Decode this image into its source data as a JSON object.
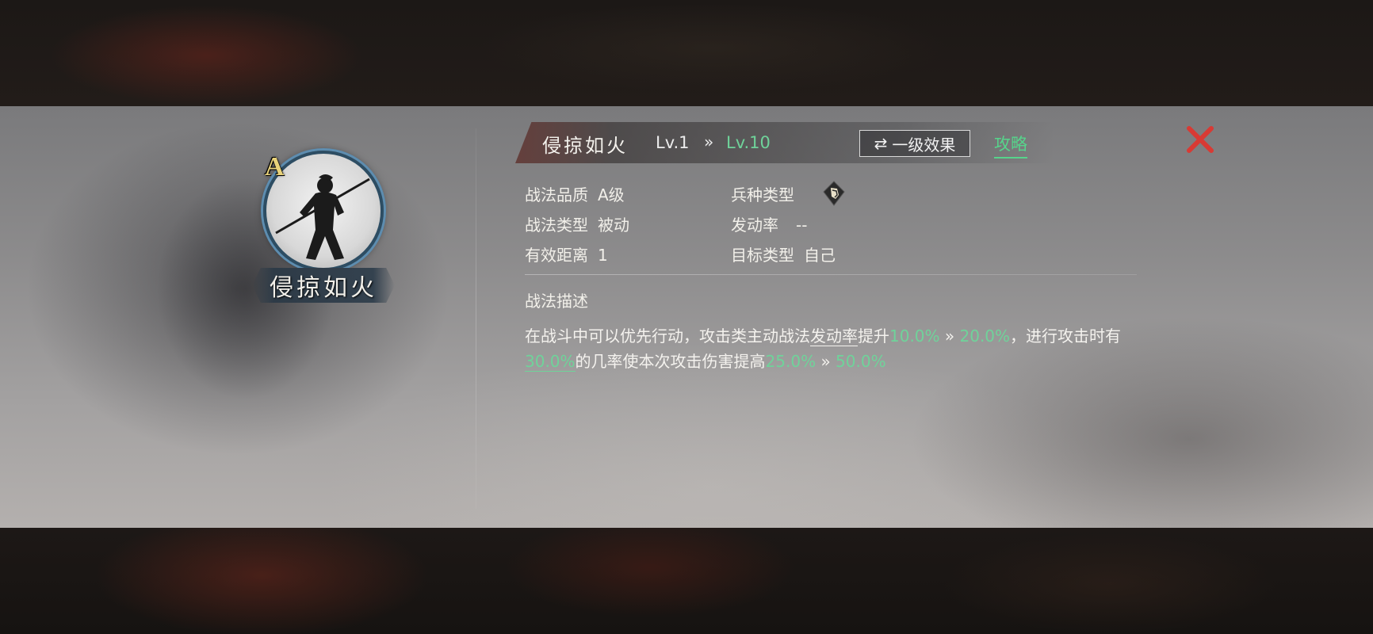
{
  "skill": {
    "name": "侵掠如火",
    "grade_badge": "A",
    "level_from": "Lv.1",
    "level_arrow": "»",
    "level_to": "Lv.10",
    "effect_button_icon": "⇄",
    "effect_button_label": "一级效果",
    "guide_label": "攻略"
  },
  "attributes": {
    "quality_label": "战法品质",
    "quality_value": "A级",
    "troop_type_label": "兵种类型",
    "troop_type_icon": "troop-type-icon",
    "skill_type_label": "战法类型",
    "skill_type_value": "被动",
    "trigger_rate_label": "发动率",
    "trigger_rate_value": "--",
    "range_label": "有效距离",
    "range_value": "1",
    "target_label": "目标类型",
    "target_value": "自己"
  },
  "description": {
    "title": "战法描述",
    "seg1": "在战斗中可以优先行动，攻击类主动战法",
    "seg2": "发动率",
    "seg3": "提升",
    "v1_from": "10.0%",
    "arrow1": " » ",
    "v1_to": "20.0%",
    "seg4": "，进行攻击时有",
    "v2": "30.0%",
    "seg5": "的几率使本次攻击伤害提高",
    "v3_from": "25.0%",
    "arrow2": " » ",
    "v3_to": "50.0%"
  },
  "colors": {
    "accent_green": "#6fd39a",
    "close_red": "#d83a34",
    "grade_gold": "#e8d27a"
  }
}
